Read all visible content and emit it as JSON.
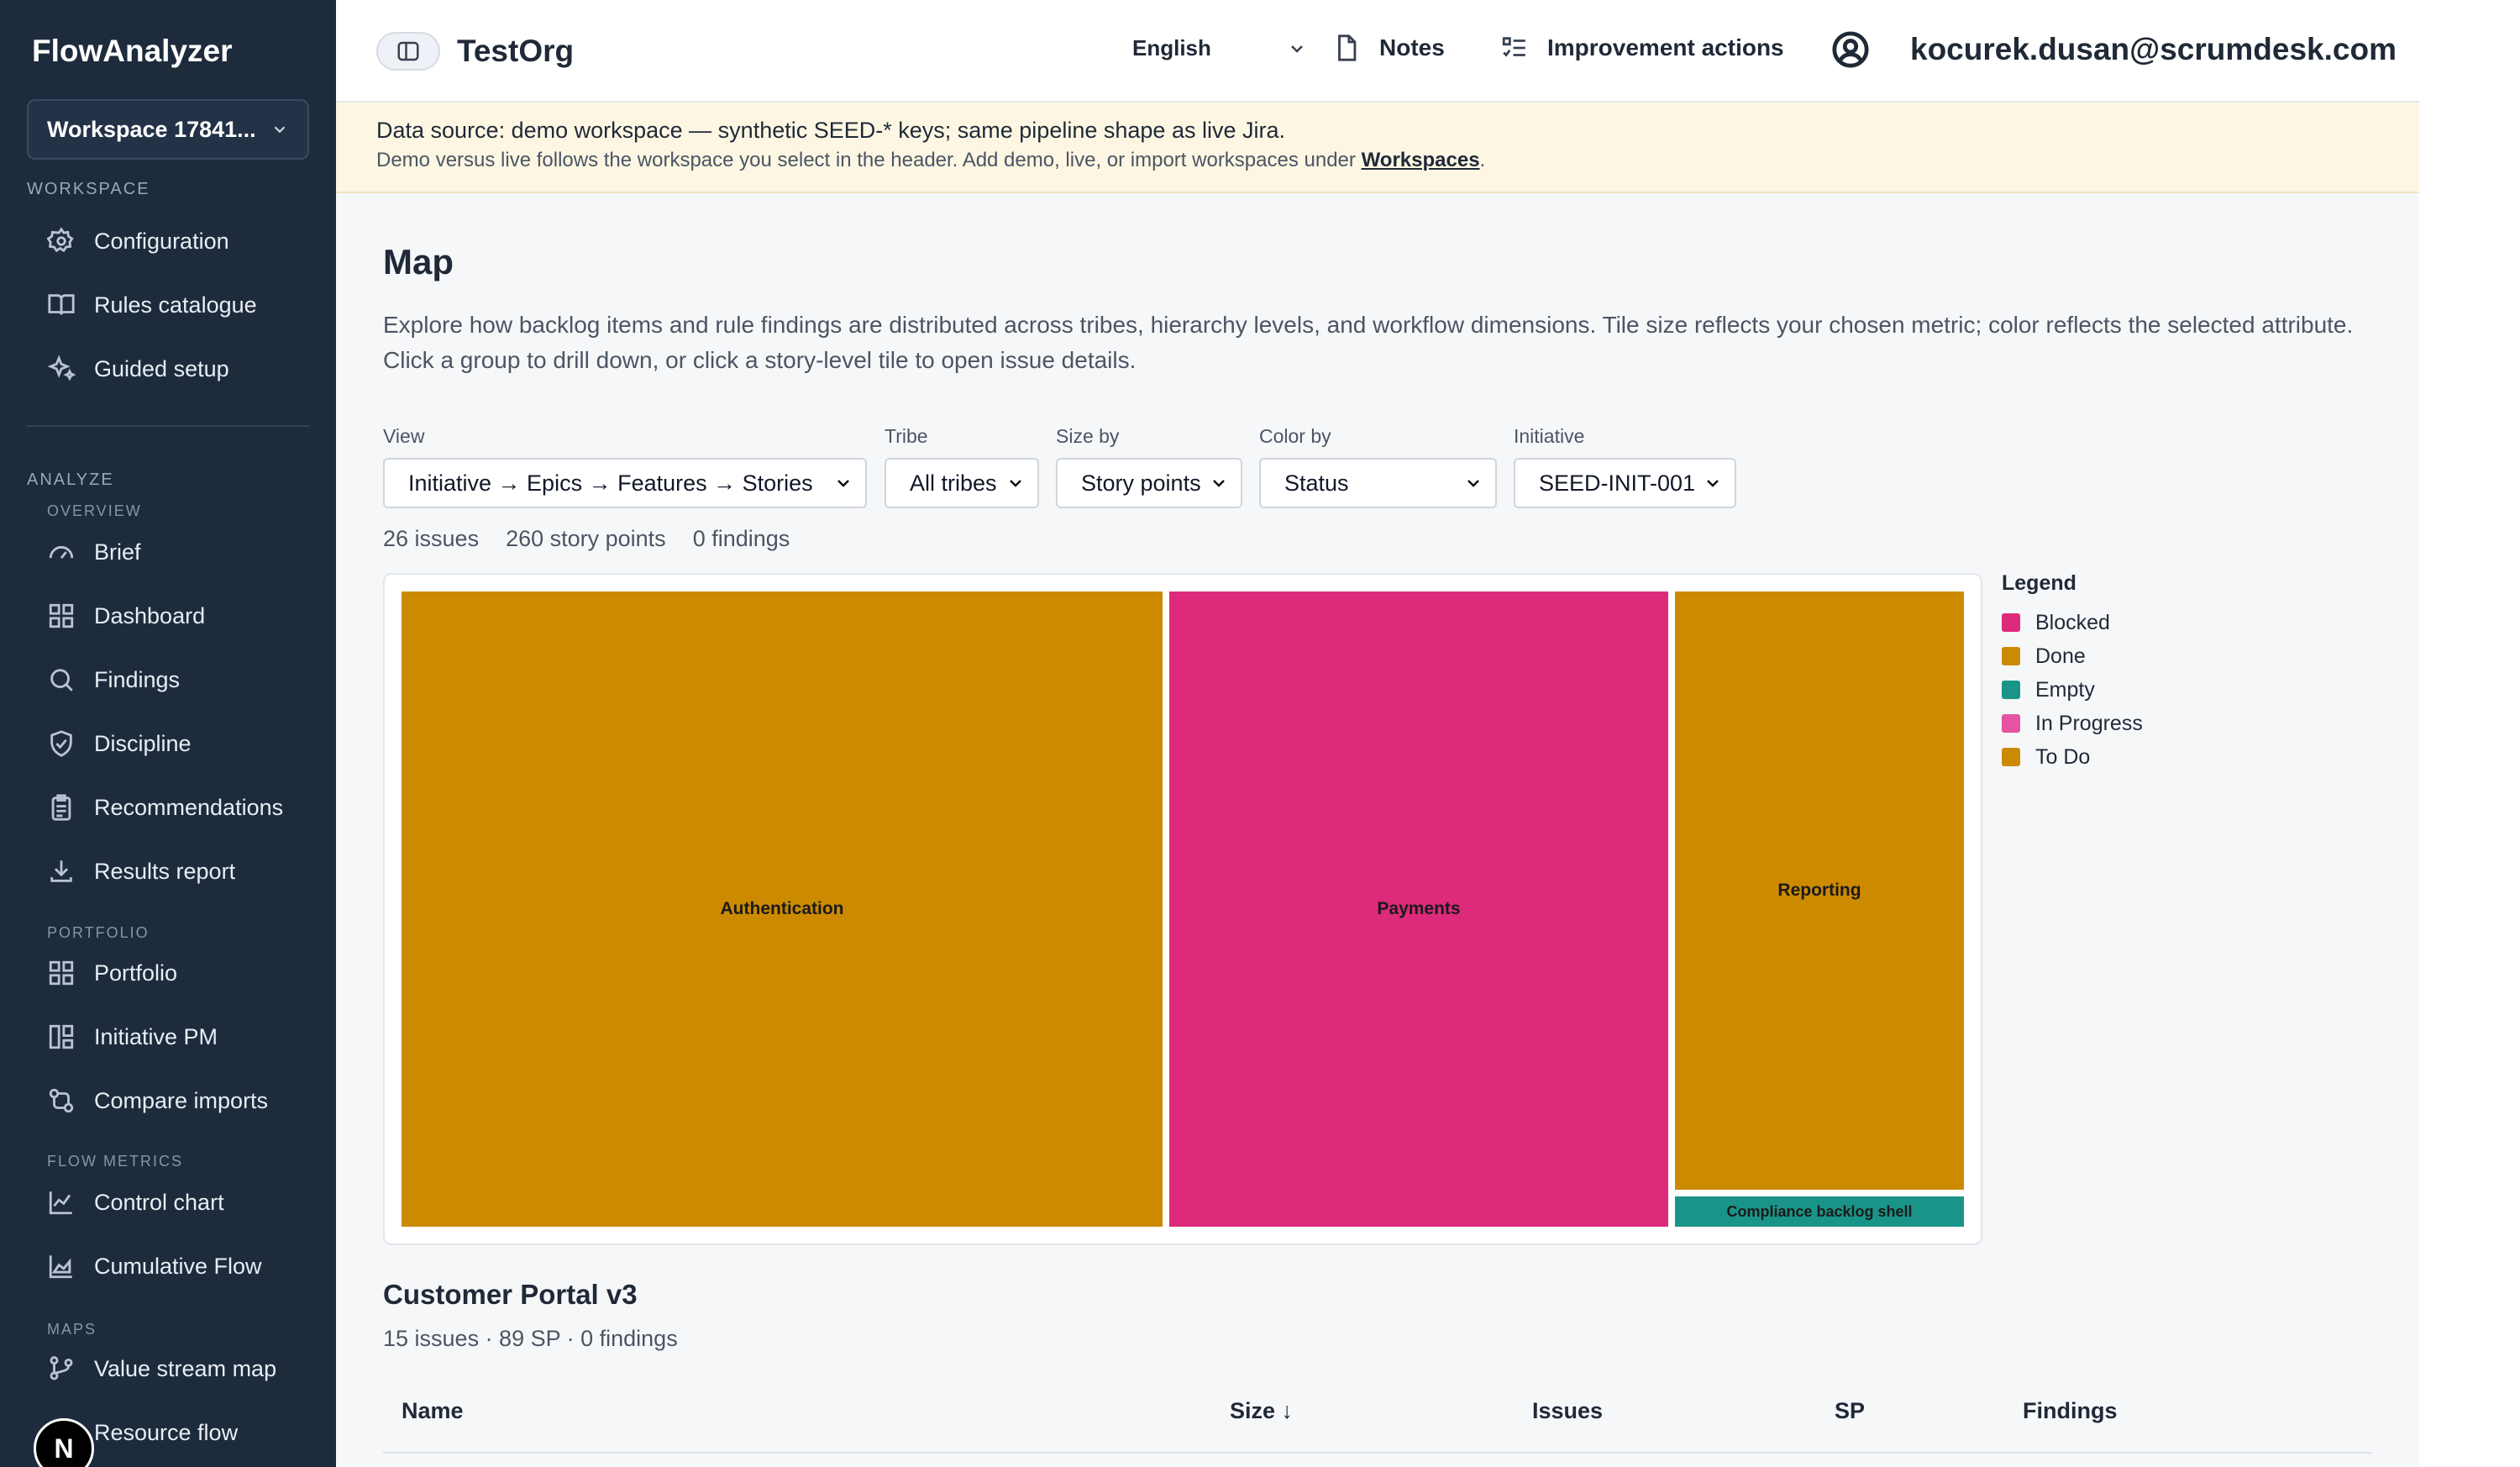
{
  "sidebar": {
    "brand": "FlowAnalyzer",
    "workspace_select": "Workspace 17841...",
    "sections": {
      "workspace": "WORKSPACE",
      "analyze": "ANALYZE",
      "overview": "OVERVIEW",
      "portfolio": "PORTFOLIO",
      "flow_metrics": "FLOW METRICS",
      "maps": "MAPS"
    },
    "items": {
      "configuration": "Configuration",
      "rules_catalogue": "Rules catalogue",
      "guided_setup": "Guided setup",
      "brief": "Brief",
      "dashboard": "Dashboard",
      "findings": "Findings",
      "discipline": "Discipline",
      "recommendations": "Recommendations",
      "results_report": "Results report",
      "portfolio": "Portfolio",
      "initiative_pm": "Initiative PM",
      "compare_imports": "Compare imports",
      "control_chart": "Control chart",
      "cumulative_flow": "Cumulative Flow",
      "value_stream_map": "Value stream map",
      "resource_flow": "Resource flow"
    },
    "avatar_letter": "N"
  },
  "header": {
    "org": "TestOrg",
    "language": "English",
    "notes": "Notes",
    "improvement_actions": "Improvement actions",
    "user_email": "kocurek.dusan@scrumdesk.com"
  },
  "banner": {
    "line1": "Data source: demo workspace — synthetic SEED-* keys; same pipeline shape as live Jira.",
    "line2_prefix": "Demo versus live follows the workspace you select in the header. Add demo, live, or import workspaces under ",
    "line2_link": "Workspaces",
    "line2_suffix": "."
  },
  "page": {
    "title": "Map",
    "description": "Explore how backlog items and rule findings are distributed across tribes, hierarchy levels, and workflow dimensions. Tile size reflects your chosen metric; color reflects the selected attribute. Click a group to drill down, or click a story-level tile to open issue details."
  },
  "filters": {
    "view": {
      "label": "View",
      "value": "Initiative → Epics → Features → Stories"
    },
    "tribe": {
      "label": "Tribe",
      "value": "All tribes"
    },
    "size_by": {
      "label": "Size by",
      "value": "Story points"
    },
    "color_by": {
      "label": "Color by",
      "value": "Status"
    },
    "initiative": {
      "label": "Initiative",
      "value": "SEED-INIT-001"
    }
  },
  "stats": {
    "issues": "26 issues",
    "story_points": "260 story points",
    "findings": "0 findings"
  },
  "treemap": {
    "tiles": [
      {
        "label": "Authentication",
        "color": "#cc8a00"
      },
      {
        "label": "Payments",
        "color": "#dd2a7b"
      },
      {
        "label": "Reporting",
        "color": "#cc8a00"
      },
      {
        "label": "Compliance backlog shell",
        "color": "#1a9488"
      }
    ]
  },
  "legend": {
    "title": "Legend",
    "items": [
      {
        "label": "Blocked",
        "color": "#dd2a7b"
      },
      {
        "label": "Done",
        "color": "#cc8a00"
      },
      {
        "label": "Empty",
        "color": "#1a9488"
      },
      {
        "label": "In Progress",
        "color": "#e553a1"
      },
      {
        "label": "To Do",
        "color": "#cc8a00"
      }
    ]
  },
  "section": {
    "title": "Customer Portal v3",
    "subtitle": "15 issues · 89 SP · 0 findings"
  },
  "table": {
    "headers": {
      "name": "Name",
      "size": "Size ↓",
      "issues": "Issues",
      "sp": "SP",
      "findings": "Findings"
    }
  }
}
